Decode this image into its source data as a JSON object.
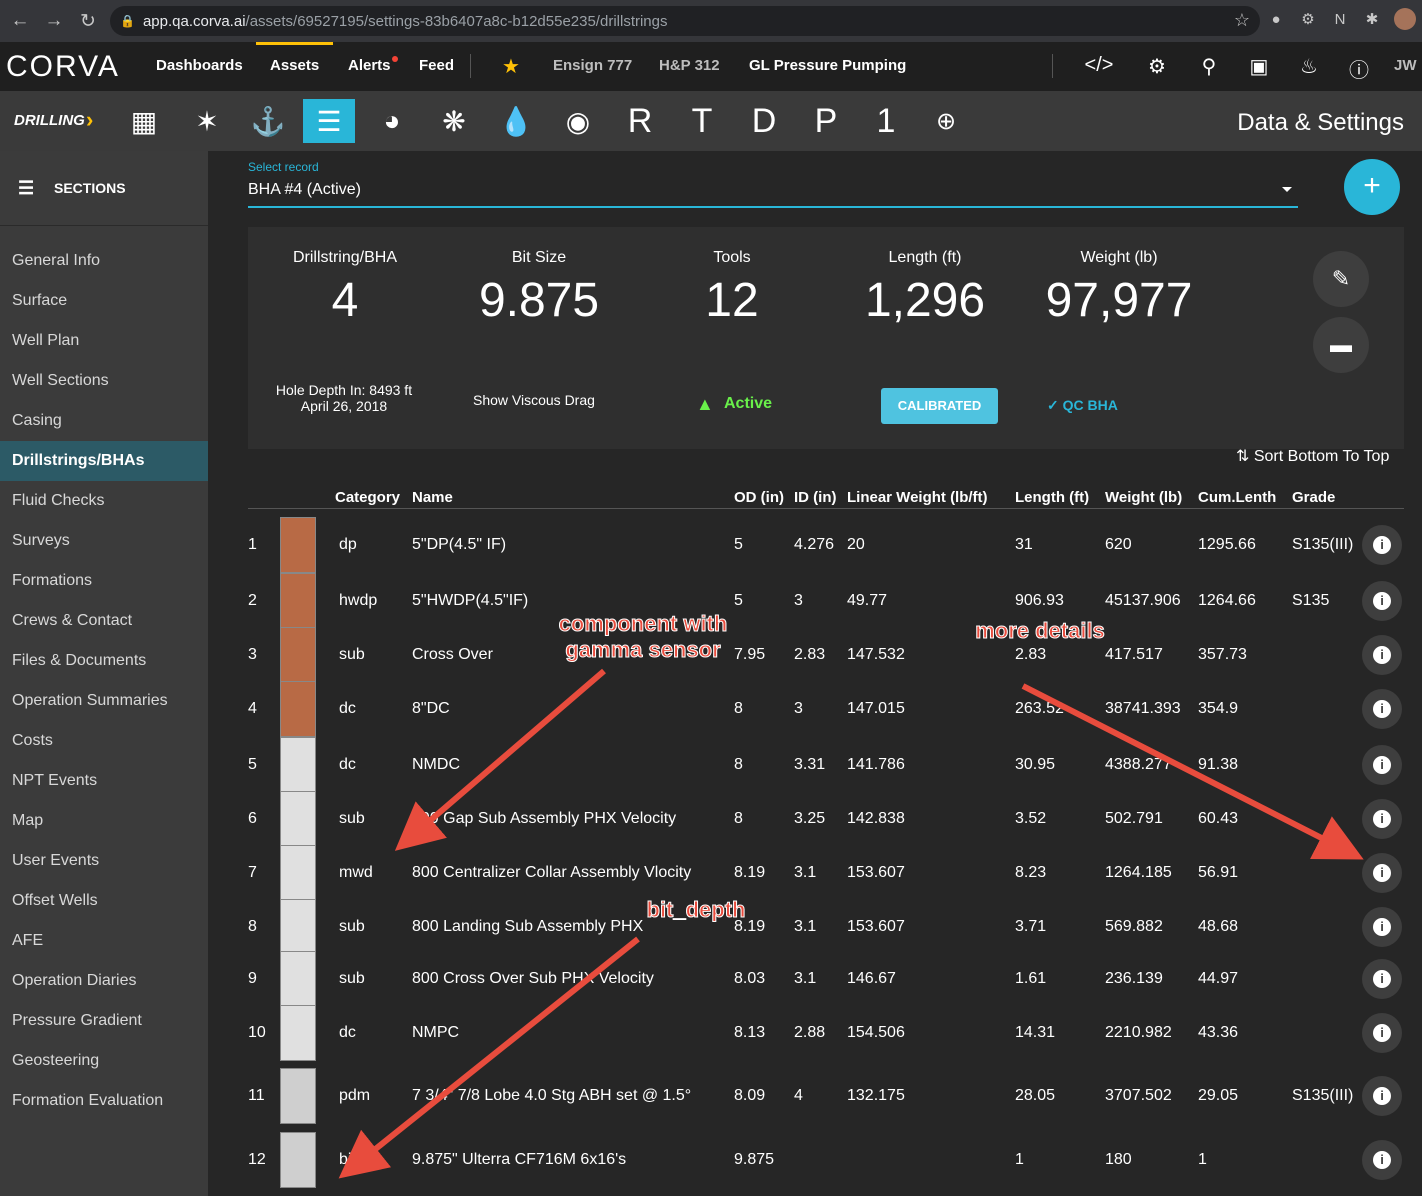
{
  "browser": {
    "url_host": "app.qa.corva.ai",
    "url_path": "/assets/69527195/settings-83b6407a8c-b12d55e235/drillstrings"
  },
  "topnav": {
    "logo": "CORVA",
    "links": [
      "Dashboards",
      "Assets",
      "Alerts",
      "Feed"
    ],
    "favorites": [
      "Ensign 777",
      "H&P 312",
      "GL Pressure Pumping"
    ],
    "user_initials": "JW"
  },
  "appbar": {
    "segment": "DRILLING",
    "letter_apps": [
      "R",
      "T",
      "D",
      "P",
      "1"
    ],
    "page_title": "Data & Settings"
  },
  "sidebar": {
    "header": "SECTIONS",
    "items": [
      "General Info",
      "Surface",
      "Well Plan",
      "Well Sections",
      "Casing",
      "Drillstrings/BHAs",
      "Fluid Checks",
      "Surveys",
      "Formations",
      "Crews & Contact",
      "Files & Documents",
      "Operation Summaries",
      "Costs",
      "NPT Events",
      "Map",
      "User Events",
      "Offset Wells",
      "AFE",
      "Operation Diaries",
      "Pressure Gradient",
      "Geosteering",
      "Formation Evaluation"
    ],
    "active": "Drillstrings/BHAs"
  },
  "record": {
    "label": "Select record",
    "value": "BHA #4 (Active)"
  },
  "summary": {
    "stats": [
      {
        "label": "Drillstring/BHA",
        "value": "4"
      },
      {
        "label": "Bit Size",
        "value": "9.875"
      },
      {
        "label": "Tools",
        "value": "12"
      },
      {
        "label": "Length (ft)",
        "value": "1,296"
      },
      {
        "label": "Weight (lb)",
        "value": "97,977"
      }
    ],
    "hole_depth": "Hole Depth In: 8493 ft",
    "hole_date": "April 26, 2018",
    "viscous_drag": "Show Viscous Drag",
    "status": "Active",
    "calibrated": "CALIBRATED",
    "qc": "QC BHA",
    "sort": "Sort Bottom To Top"
  },
  "table": {
    "headers": [
      "Category",
      "Name",
      "OD (in)",
      "ID (in)",
      "Linear Weight (lb/ft)",
      "Length (ft)",
      "Weight (lb)",
      "Cum.Lenth",
      "Grade"
    ],
    "rows": [
      {
        "n": "1",
        "cat": "dp",
        "name": "5\"DP(4.5\" IF)",
        "od": "5",
        "id": "4.276",
        "lw": "20",
        "len": "31",
        "wt": "620",
        "cum": "1295.66",
        "grade": "S135(III)"
      },
      {
        "n": "2",
        "cat": "hwdp",
        "name": "5\"HWDP(4.5\"IF)",
        "od": "5",
        "id": "3",
        "lw": "49.77",
        "len": "906.93",
        "wt": "45137.906",
        "cum": "1264.66",
        "grade": "S135"
      },
      {
        "n": "3",
        "cat": "sub",
        "name": "Cross Over",
        "od": "7.95",
        "id": "2.83",
        "lw": "147.532",
        "len": "2.83",
        "wt": "417.517",
        "cum": "357.73",
        "grade": ""
      },
      {
        "n": "4",
        "cat": "dc",
        "name": "8\"DC",
        "od": "8",
        "id": "3",
        "lw": "147.015",
        "len": "263.52",
        "wt": "38741.393",
        "cum": "354.9",
        "grade": ""
      },
      {
        "n": "5",
        "cat": "dc",
        "name": "NMDC",
        "od": "8",
        "id": "3.31",
        "lw": "141.786",
        "len": "30.95",
        "wt": "4388.277",
        "cum": "91.38",
        "grade": ""
      },
      {
        "n": "6",
        "cat": "sub",
        "name": "800 Gap Sub Assembly PHX Velocity",
        "od": "8",
        "id": "3.25",
        "lw": "142.838",
        "len": "3.52",
        "wt": "502.791",
        "cum": "60.43",
        "grade": ""
      },
      {
        "n": "7",
        "cat": "mwd",
        "name": "800 Centralizer Collar Assembly Vlocity",
        "od": "8.19",
        "id": "3.1",
        "lw": "153.607",
        "len": "8.23",
        "wt": "1264.185",
        "cum": "56.91",
        "grade": ""
      },
      {
        "n": "8",
        "cat": "sub",
        "name": "800 Landing Sub Assembly PHX",
        "od": "8.19",
        "id": "3.1",
        "lw": "153.607",
        "len": "3.71",
        "wt": "569.882",
        "cum": "48.68",
        "grade": ""
      },
      {
        "n": "9",
        "cat": "sub",
        "name": "800 Cross Over Sub PHX Velocity",
        "od": "8.03",
        "id": "3.1",
        "lw": "146.67",
        "len": "1.61",
        "wt": "236.139",
        "cum": "44.97",
        "grade": ""
      },
      {
        "n": "10",
        "cat": "dc",
        "name": "NMPC",
        "od": "8.13",
        "id": "2.88",
        "lw": "154.506",
        "len": "14.31",
        "wt": "2210.982",
        "cum": "43.36",
        "grade": ""
      },
      {
        "n": "11",
        "cat": "pdm",
        "name": "7 3/4\" 7/8 Lobe 4.0 Stg ABH set @ 1.5°",
        "od": "8.09",
        "id": "4",
        "lw": "132.175",
        "len": "28.05",
        "wt": "3707.502",
        "cum": "29.05",
        "grade": "S135(III)"
      },
      {
        "n": "12",
        "cat": "bit",
        "name": "9.875\" Ulterra CF716M 6x16's",
        "od": "9.875",
        "id": "",
        "lw": "",
        "len": "1",
        "wt": "180",
        "cum": "1",
        "grade": ""
      }
    ]
  },
  "annotations": {
    "gamma": "component with\ngamma sensor",
    "details": "more details",
    "bit_depth": "bit_depth"
  },
  "colors": {
    "accent": "#29b6d8",
    "active": "#69f04a",
    "annotation": "#e84c3d",
    "pipe": "#b86a45"
  }
}
